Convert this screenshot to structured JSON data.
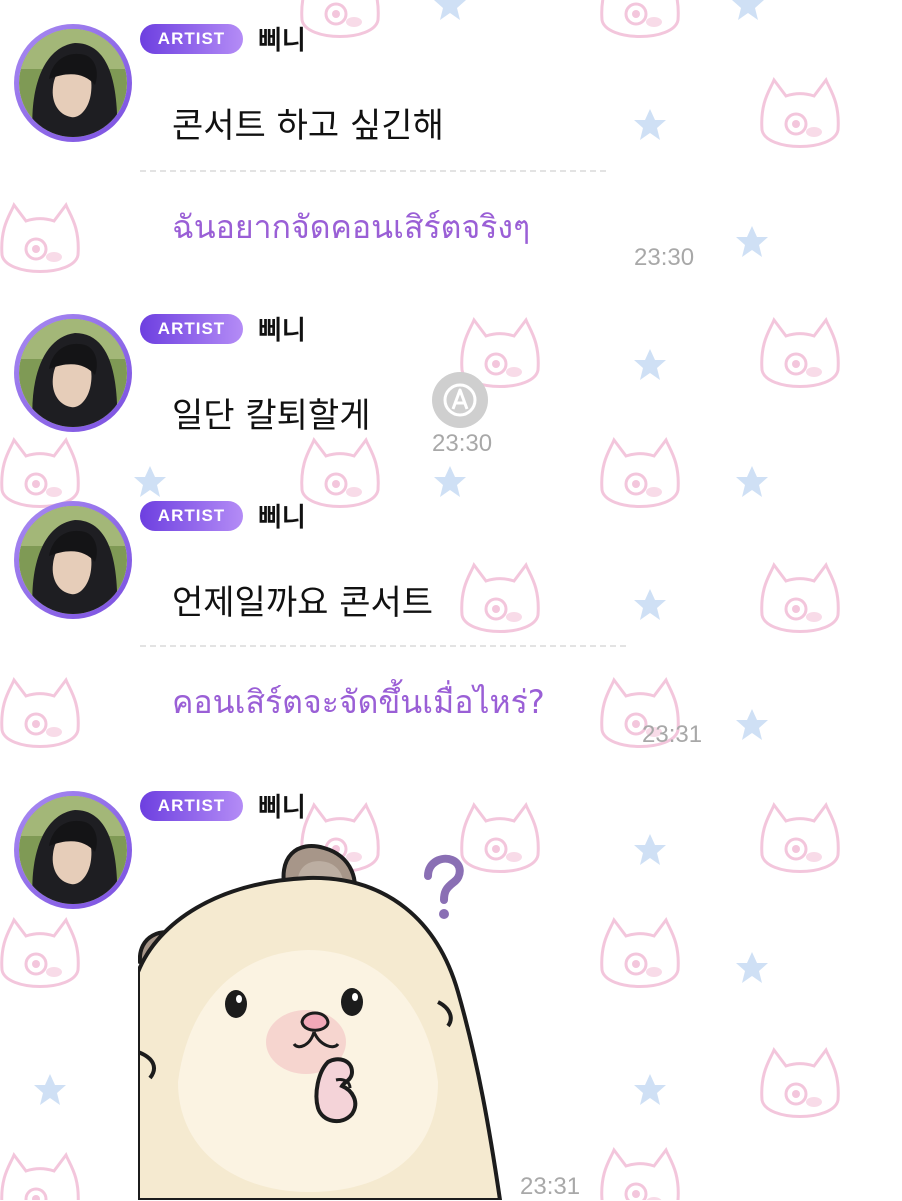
{
  "messages": [
    {
      "badge": "ARTIST",
      "sender": "삐니",
      "text": "콘서트 하고 싶긴해",
      "translation": "ฉันอยากจัดคอนเสิร์ตจริงๆ",
      "time": "23:30"
    },
    {
      "badge": "ARTIST",
      "sender": "삐니",
      "text": "일단 칼퇴할게",
      "time": "23:30"
    },
    {
      "badge": "ARTIST",
      "sender": "삐니",
      "text": "언제일까요 콘서트",
      "translation": "คอนเสิร์ตจะจัดขึ้นเมื่อไหร่?",
      "time": "23:31"
    },
    {
      "badge": "ARTIST",
      "sender": "삐니",
      "sticker": "hamster-question-sticker",
      "time": "23:31"
    }
  ],
  "colors": {
    "badge_start": "#6d3fe0",
    "badge_end": "#b48cf6",
    "translation_text": "#9a5fd6",
    "timestamp": "#a8a8a8",
    "pattern_cat": "#f3c6dc",
    "pattern_star": "#cfe0f5"
  },
  "icons": [
    "translate-icon",
    "cat-pattern-icon",
    "star-pattern-icon",
    "question-mark-icon"
  ]
}
